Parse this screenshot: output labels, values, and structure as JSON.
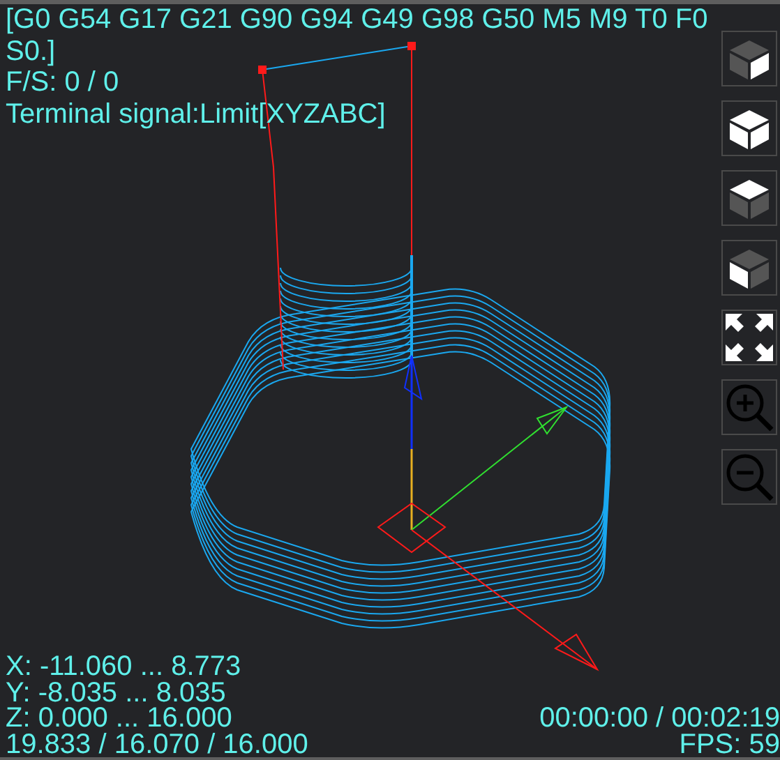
{
  "viewer": {
    "parser_state": "[G0 G54 G17 G21 G90 G94 G49 G98 G50 M5 M9 T0 F0 S0.]",
    "feed_spindle": "F/S: 0 / 0",
    "terminal_signal": "Terminal signal:Limit[XYZABC]"
  },
  "view_buttons": [
    {
      "kind": "cube-right"
    },
    {
      "kind": "cube-iso"
    },
    {
      "kind": "cube-top"
    },
    {
      "kind": "cube-left"
    },
    {
      "kind": "fit"
    },
    {
      "kind": "zoom-in"
    },
    {
      "kind": "zoom-out"
    }
  ],
  "bounds": [
    "X: -11.060 ... 8.773",
    "Y: -8.035 ... 8.035",
    "Z: 0.000 ... 16.000"
  ],
  "size": "19.833 / 16.070 / 16.000",
  "time": "00:00:00 / 00:02:19",
  "fps": "FPS: 59"
}
